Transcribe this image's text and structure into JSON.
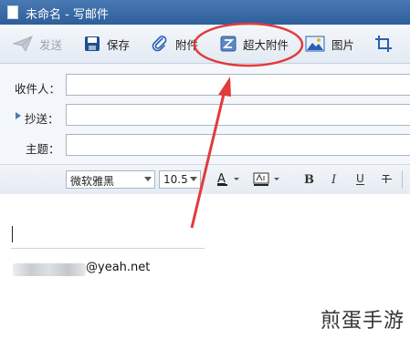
{
  "window": {
    "title": "未命名 - 写邮件"
  },
  "toolbar": {
    "send_label": "发送",
    "save_label": "保存",
    "attach_label": "附件",
    "large_attach_label": "超大附件",
    "image_label": "图片"
  },
  "fields": {
    "to_label": "收件人：",
    "cc_label": "抄送：",
    "subject_label": "主题："
  },
  "format": {
    "font_family": "微软雅黑",
    "font_size": "10.5"
  },
  "editor": {
    "signature_email_suffix": "@yeah.net"
  },
  "watermark": {
    "text": "煎蛋手游"
  },
  "colors": {
    "annotation": "#e23b3b",
    "titlebar": "#3a6aa8",
    "accent_icon": "#2a5fb0"
  }
}
